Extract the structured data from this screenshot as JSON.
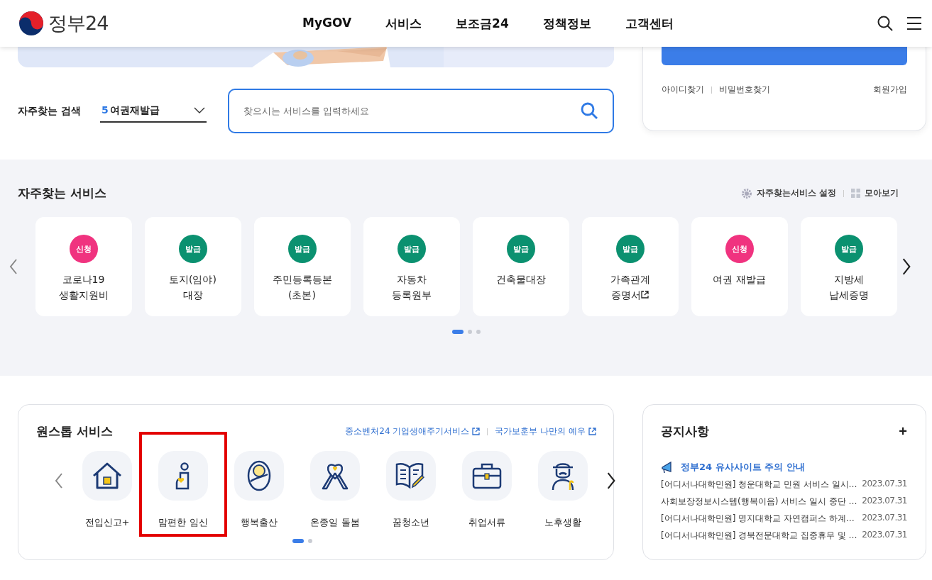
{
  "header": {
    "logo": "정부24",
    "nav": [
      {
        "label": "MyGOV"
      },
      {
        "label": "서비스"
      },
      {
        "label": "보조금24"
      },
      {
        "label": "정책정보"
      },
      {
        "label": "고객센터"
      }
    ]
  },
  "search": {
    "label": "자주찾는 검색",
    "rank": "5",
    "keyword": "여권재발급",
    "placeholder": "찾으시는 서비스를 입력하세요"
  },
  "login": {
    "links": [
      {
        "label": "아이디찾기"
      },
      {
        "label": "비밀번호찾기"
      }
    ],
    "signup": "회원가입"
  },
  "frequent": {
    "title": "자주찾는 서비스",
    "actions": [
      {
        "label": "자주찾는서비스 설정"
      },
      {
        "label": "모아보기"
      }
    ],
    "items": [
      {
        "badge": "신청",
        "color": "#f0337f",
        "lines": [
          "코로나19",
          "생활지원비"
        ],
        "external": false
      },
      {
        "badge": "발급",
        "color": "#0b9170",
        "lines": [
          "토지(임야)",
          "대장"
        ],
        "external": false
      },
      {
        "badge": "발급",
        "color": "#0b9170",
        "lines": [
          "주민등록등본",
          "(초본)"
        ],
        "external": false
      },
      {
        "badge": "발급",
        "color": "#0b9170",
        "lines": [
          "자동차",
          "등록원부"
        ],
        "external": false
      },
      {
        "badge": "발급",
        "color": "#0b9170",
        "lines": [
          "건축물대장"
        ],
        "external": false
      },
      {
        "badge": "발급",
        "color": "#0b9170",
        "lines": [
          "가족관계",
          "증명서"
        ],
        "external": true
      },
      {
        "badge": "신청",
        "color": "#f0337f",
        "lines": [
          "여권 재발급"
        ],
        "external": false
      },
      {
        "badge": "발급",
        "color": "#0b9170",
        "lines": [
          "지방세",
          "납세증명"
        ],
        "external": false
      }
    ],
    "pages": [
      {
        "selected": true
      },
      {
        "selected": false
      },
      {
        "selected": false
      }
    ]
  },
  "onestop": {
    "title": "원스톱 서비스",
    "links": [
      {
        "label": "중소벤처24 기업생애주기서비스"
      },
      {
        "label": "국가보훈부 나만의 예우"
      }
    ],
    "items": [
      {
        "label": "전입신고+",
        "highlighted": false
      },
      {
        "label": "맘편한 임신",
        "highlighted": true
      },
      {
        "label": "행복출산",
        "highlighted": false
      },
      {
        "label": "온종일 돌봄",
        "highlighted": false
      },
      {
        "label": "꿈청소년",
        "highlighted": false
      },
      {
        "label": "취업서류",
        "highlighted": false
      },
      {
        "label": "노후생활",
        "highlighted": false
      }
    ],
    "pages": [
      {
        "selected": true
      },
      {
        "selected": false
      }
    ]
  },
  "notices": {
    "title": "공지사항",
    "more": "+",
    "pinned": "정부24 유사사이트 주의 안내",
    "items": [
      {
        "title": "[어디서나대학민원] 청운대학교 민원 서비스 일시…",
        "date": "2023.07.31"
      },
      {
        "title": "사회보장정보시스템(행복이음) 서비스 일시 중단 …",
        "date": "2023.07.31"
      },
      {
        "title": "[어디서나대학민원] 명지대학교 자연캠퍼스 하계…",
        "date": "2023.07.31"
      },
      {
        "title": "[어디서나대학민원] 경북전문대학교 집중휴무 및 …",
        "date": "2023.07.31"
      }
    ]
  }
}
